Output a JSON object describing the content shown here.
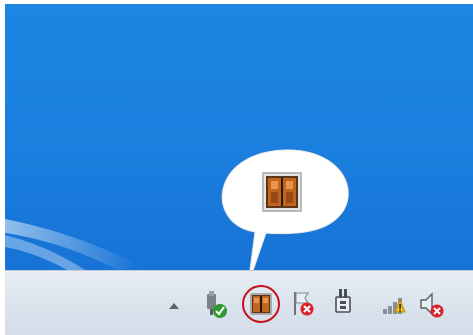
{
  "colors": {
    "desktop_blue": "#1a7fde",
    "taskbar": "#dde5ee",
    "highlight_ring": "#c4101c",
    "callout_fill": "#ffffff"
  },
  "tray": {
    "icons": [
      {
        "name": "show-hidden-icons-arrow-icon"
      },
      {
        "name": "safely-remove-hardware-icon"
      },
      {
        "name": "app-tray-icon"
      },
      {
        "name": "action-center-flag-icon"
      },
      {
        "name": "power-icon"
      },
      {
        "name": "network-signal-icon"
      },
      {
        "name": "volume-muted-icon"
      }
    ]
  },
  "callout": {
    "icon_name": "app-large-icon"
  }
}
